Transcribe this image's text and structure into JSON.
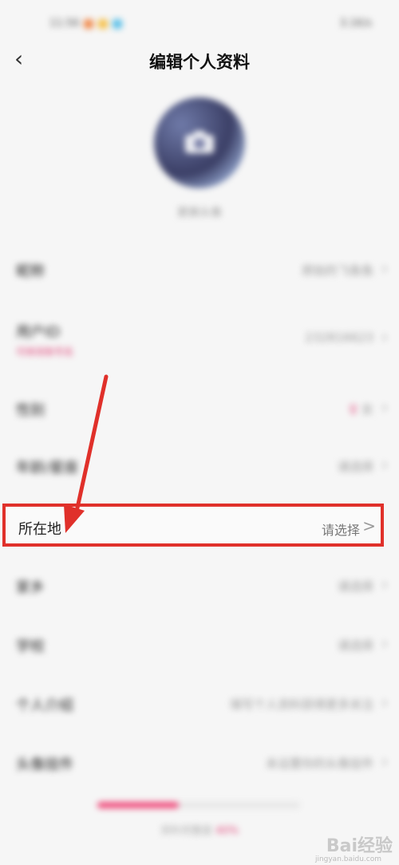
{
  "status_bar": {
    "time": "11:56",
    "right_text": "3.1K/s"
  },
  "nav": {
    "back_icon": "‹",
    "title": "编辑个人资料"
  },
  "avatar": {
    "label": "更换头像"
  },
  "rows": [
    {
      "label": "昵称",
      "value": "原始的飞鱼鱼",
      "chevron": "›"
    },
    {
      "label": "用户ID",
      "sub": "可修改账号名",
      "value": "232816623",
      "chevron": "›"
    },
    {
      "label": "性别",
      "value": "女",
      "icon": "♀",
      "chevron": "›"
    },
    {
      "label": "年龄/星座",
      "value": "请选择",
      "chevron": "›"
    },
    {
      "label": "家乡",
      "value": "请选择",
      "chevron": "›"
    },
    {
      "label": "学校",
      "value": "请选择",
      "chevron": "›"
    },
    {
      "label": "个人介绍",
      "value": "填写个人资料获得更多关注",
      "chevron": "›"
    },
    {
      "label": "头像挂件",
      "value": "未设置你的头像挂件",
      "chevron": "›"
    }
  ],
  "highlighted_row": {
    "label": "所在地",
    "value": "请选择",
    "chevron": ">"
  },
  "progress": {
    "fraction": 0.4,
    "text": "资料完整度",
    "percent_text": "40%"
  },
  "watermark": {
    "text": "Bai经验",
    "sub": "jingyan.baidu.com"
  },
  "colors": {
    "accent": "#e0457a",
    "annotation": "#e0302a"
  }
}
